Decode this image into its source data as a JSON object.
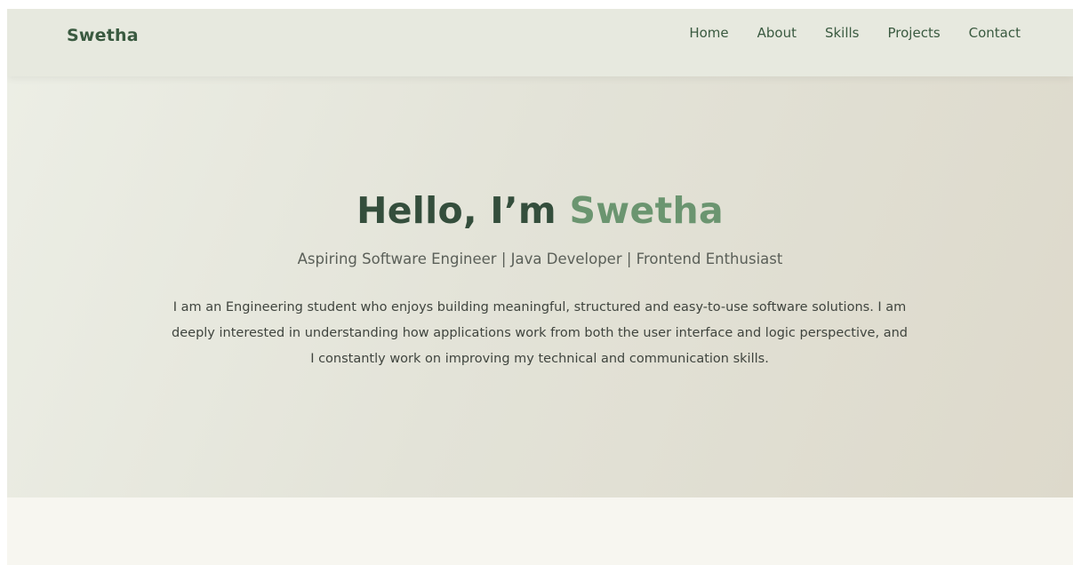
{
  "header": {
    "logo": "Swetha",
    "nav": [
      "Home",
      "About",
      "Skills",
      "Projects",
      "Contact"
    ]
  },
  "hero": {
    "title_prefix": "Hello, I’m ",
    "title_name": "Swetha",
    "subtitle": "Aspiring Software Engineer | Java Developer | Frontend Enthusiast",
    "description": "I am an Engineering student who enjoys building meaningful, structured and easy-to-use software solutions. I am deeply interested in understanding how applications work from both the user interface and logic perspective, and I constantly work on improving my technical and communication skills."
  },
  "colors": {
    "primary_green": "#3a5a40",
    "accent_green": "#6b9570",
    "navbar_bg": "#e7e9df",
    "page_bg": "#f7f6f0"
  }
}
